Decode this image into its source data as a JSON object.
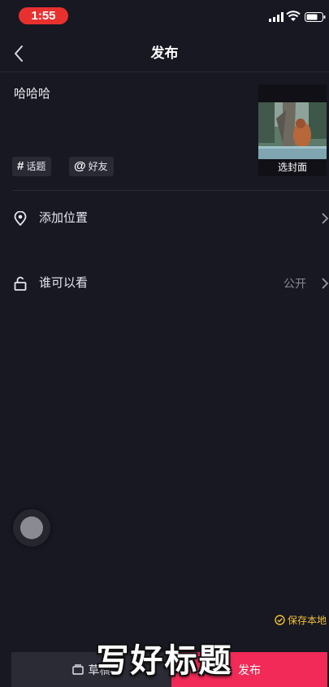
{
  "status_bar": {
    "time": "1:55",
    "icons": [
      "signal-icon",
      "wifi-icon",
      "battery-icon"
    ],
    "time_pill_color": "#e8312f"
  },
  "header": {
    "title": "发布",
    "back_icon": "chevron-left-icon"
  },
  "caption": {
    "text": "哈哈哈"
  },
  "cover": {
    "label": "选封面"
  },
  "tags": {
    "topic": {
      "symbol": "#",
      "label": "话题"
    },
    "friends": {
      "symbol": "@",
      "label": "好友"
    }
  },
  "settings": {
    "location": {
      "label": "添加位置",
      "icon": "location-pin-icon"
    },
    "privacy": {
      "label": "谁可以看",
      "value": "公开",
      "icon": "unlock-icon"
    }
  },
  "save_local": {
    "label": "保存本地",
    "checked": true,
    "color": "#f0c23a"
  },
  "footer": {
    "draft_label": "草稿",
    "publish_label": "发布",
    "publish_color": "#f12a57"
  },
  "overlay": {
    "subtitle": "写好标题"
  }
}
